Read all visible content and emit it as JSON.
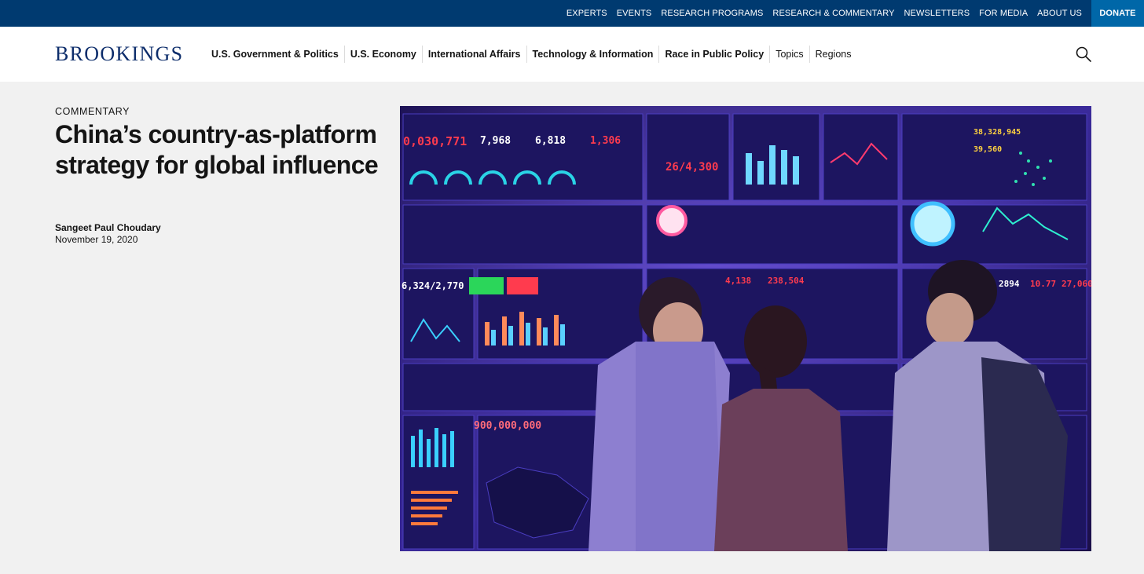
{
  "topnav": {
    "items": [
      "EXPERTS",
      "EVENTS",
      "RESEARCH PROGRAMS",
      "RESEARCH & COMMENTARY",
      "NEWSLETTERS",
      "FOR MEDIA",
      "ABOUT US"
    ],
    "donate": "DONATE"
  },
  "header": {
    "logo": "BROOKINGS",
    "nav": [
      "U.S. Government & Politics",
      "U.S. Economy",
      "International Affairs",
      "Technology & Information",
      "Race in Public Policy",
      "Topics",
      "Regions"
    ]
  },
  "article": {
    "kicker": "COMMENTARY",
    "title": "China’s country-as-platform strategy for global influence",
    "author": "Sangeet Paul Choudary",
    "date": "November 19, 2020"
  },
  "hero": {
    "readouts": [
      "0,030,771",
      "7,968",
      "6,818",
      "1,306",
      "26/4,300",
      "38,328,945",
      "39,560",
      "6,324/2,770",
      "4,138",
      "238,504",
      "2894",
      "10.77",
      "27,060",
      "900,000,000"
    ]
  },
  "colors": {
    "topbar": "#003a70",
    "donate": "#0067a8",
    "logo": "#0d2d6b",
    "page_bg": "#f1f1f1"
  }
}
